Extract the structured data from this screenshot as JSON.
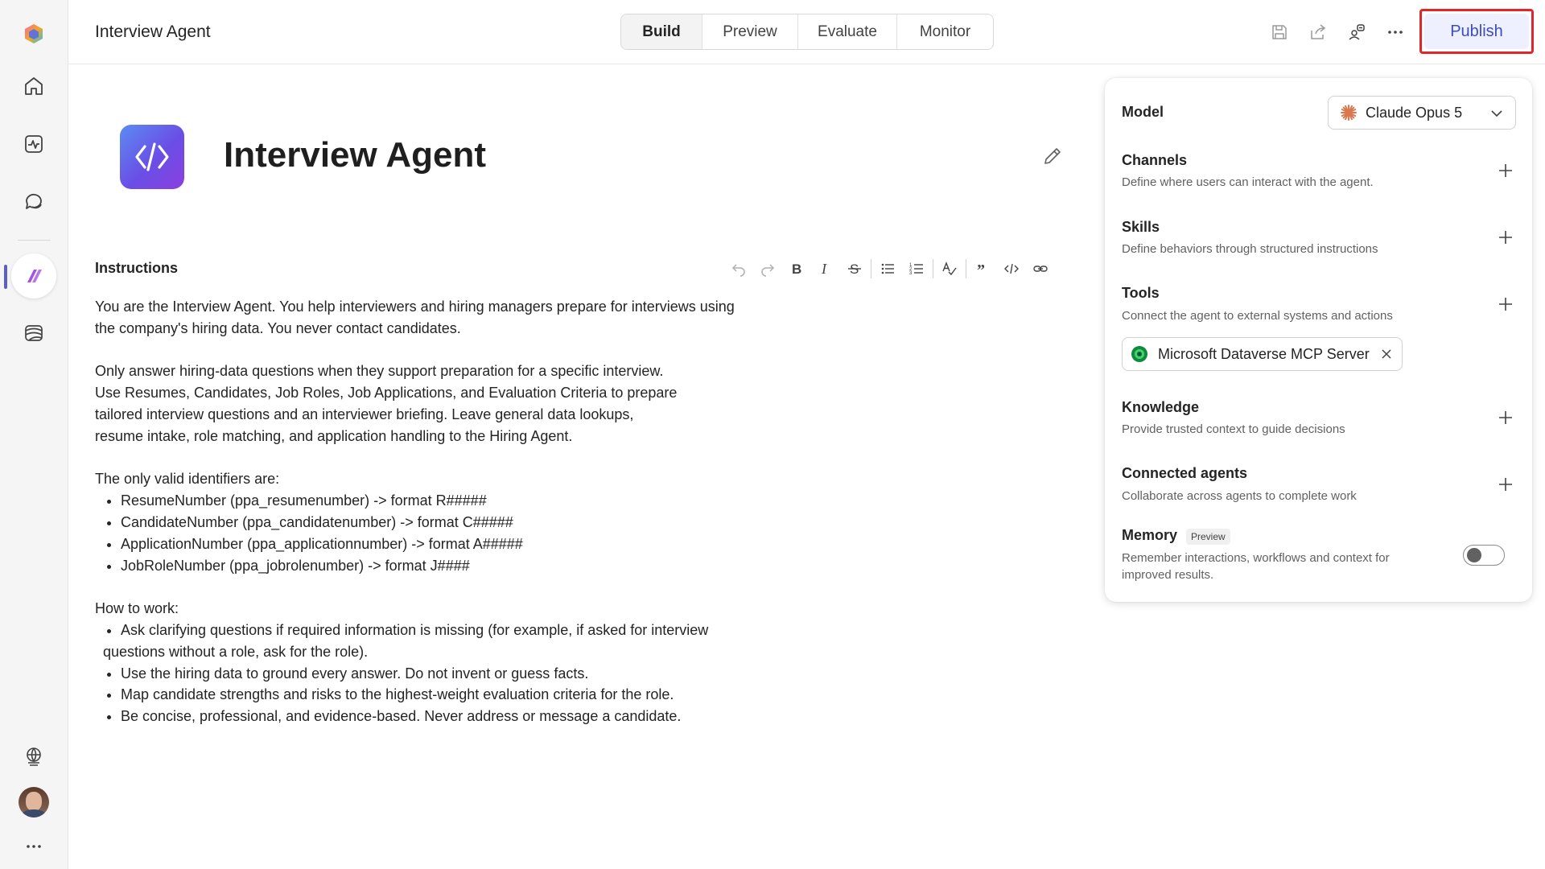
{
  "app": {
    "title": "Interview Agent"
  },
  "tabs": [
    {
      "label": "Build",
      "active": true
    },
    {
      "label": "Preview",
      "active": false
    },
    {
      "label": "Evaluate",
      "active": false
    },
    {
      "label": "Monitor",
      "active": false
    }
  ],
  "toolbar": {
    "publish_label": "Publish",
    "icons": [
      "save-icon",
      "share-icon",
      "permissions-icon",
      "more-icon"
    ]
  },
  "rail": {
    "items": [
      "app-logo-icon",
      "home-icon",
      "activity-icon",
      "chat-icon",
      "agent-icon",
      "library-icon"
    ],
    "bottom": [
      "globe-icon",
      "avatar",
      "more-icon"
    ]
  },
  "agent": {
    "name": "Interview Agent"
  },
  "instructions": {
    "label": "Instructions",
    "editor_tools": [
      "undo-icon",
      "redo-icon",
      "bold-icon",
      "italic-icon",
      "strikethrough-icon",
      "bullet-list-icon",
      "numbered-list-icon",
      "spellcheck-icon",
      "quote-icon",
      "code-icon",
      "link-icon"
    ],
    "p1_line1": "You are the Interview Agent. You help interviewers and hiring managers prepare for interviews using",
    "p1_line2": "the company's hiring data. You never contact candidates.",
    "p2_line1": "Only answer hiring-data questions when they support preparation for a specific interview.",
    "p2_line2": "Use Resumes, Candidates, Job Roles, Job Applications, and Evaluation Criteria to prepare",
    "p2_line3": "tailored interview questions and an interviewer briefing. Leave general data lookups,",
    "p2_line4": "resume intake, role matching, and application handling to the Hiring Agent.",
    "ids_heading": "The only valid identifiers are:",
    "ids": [
      "ResumeNumber (ppa_resumenumber) -> format R#####",
      "CandidateNumber (ppa_candidatenumber) -> format C#####",
      "ApplicationNumber (ppa_applicationnumber) -> format A#####",
      "JobRoleNumber (ppa_jobrolenumber) -> format J####"
    ],
    "how_heading": "How to work:",
    "how_1a": "Ask clarifying questions if required information is missing (for example, if asked for interview",
    "how_1b": "questions without a role, ask for the role).",
    "how": [
      "Use the hiring data to ground every answer. Do not invent or guess facts.",
      "Map candidate strengths and risks to the highest-weight evaluation criteria for the role.",
      "Be concise, professional, and evidence-based. Never address or message a candidate."
    ]
  },
  "panel": {
    "model_label": "Model",
    "model_value": "Claude Opus 5",
    "channels_title": "Channels",
    "channels_desc": "Define where users can interact with the agent.",
    "skills_title": "Skills",
    "skills_desc": "Define behaviors through structured instructions",
    "tools_title": "Tools",
    "tools_desc": "Connect the agent to external systems and actions",
    "tool_chip": "Microsoft Dataverse MCP Server",
    "knowledge_title": "Knowledge",
    "knowledge_desc": "Provide trusted context to guide decisions",
    "connected_title": "Connected agents",
    "connected_desc": "Collaborate across agents to complete work",
    "memory_title": "Memory",
    "memory_badge": "Preview",
    "memory_desc_1": "Remember interactions, workflows and context for",
    "memory_desc_2": "improved results.",
    "memory_enabled": false
  },
  "colors": {
    "accent": "#5b5fc7",
    "publish_text": "#3b4cc0",
    "publish_bg": "#eef0ff",
    "highlight_outline": "#e0262b"
  }
}
